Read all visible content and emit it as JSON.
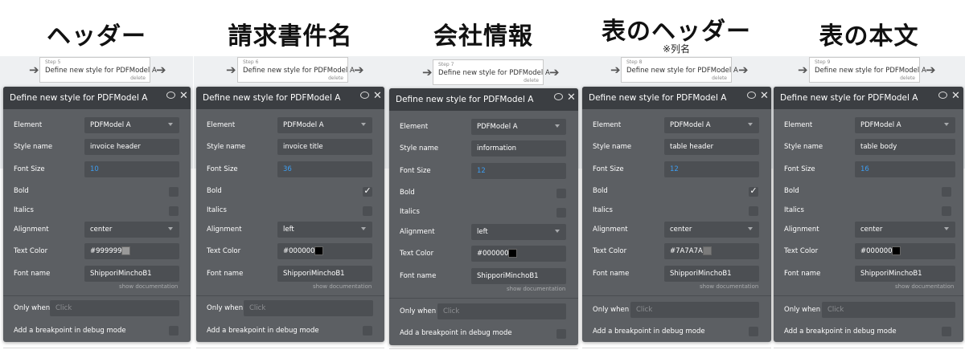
{
  "columns": [
    {
      "heading": "ヘッダー",
      "subnote": "",
      "step_number": "Step 5",
      "step_title": "Define new style for PDFModel A",
      "step_delete": "delete",
      "panel_title": "Define new style for PDFModel A",
      "element_label": "Element",
      "element_value": "PDFModel A",
      "style_label": "Style name",
      "style_value": "invoice header",
      "fontsize_label": "Font Size",
      "fontsize_value": "10",
      "bold_label": "Bold",
      "bold_checked": false,
      "italics_label": "Italics",
      "italics_checked": false,
      "align_label": "Alignment",
      "align_value": "center",
      "color_label": "Text Color",
      "color_value": "#999999",
      "color_hex": "#999999",
      "font_label": "Font name",
      "font_value": "ShipporiMinchoB1",
      "show_doc": "show documentation",
      "only_when_label": "Only when",
      "only_when_placeholder": "Click",
      "breakpoint_label": "Add a breakpoint in debug mode"
    },
    {
      "heading": "請求書件名",
      "subnote": "",
      "step_number": "Step 6",
      "step_title": "Define new style for PDFModel A",
      "step_delete": "delete",
      "panel_title": "Define new style for PDFModel A",
      "element_label": "Element",
      "element_value": "PDFModel A",
      "style_label": "Style name",
      "style_value": "invoice title",
      "fontsize_label": "Font Size",
      "fontsize_value": "36",
      "bold_label": "Bold",
      "bold_checked": true,
      "italics_label": "Italics",
      "italics_checked": false,
      "align_label": "Alignment",
      "align_value": "left",
      "color_label": "Text Color",
      "color_value": "#000000",
      "color_hex": "#000000",
      "font_label": "Font name",
      "font_value": "ShipporiMinchoB1",
      "show_doc": "show documentation",
      "only_when_label": "Only when",
      "only_when_placeholder": "Click",
      "breakpoint_label": "Add a breakpoint in debug mode"
    },
    {
      "heading": "会社情報",
      "subnote": "",
      "step_number": "Step 7",
      "step_title": "Define new style for PDFModel A",
      "step_delete": "delete",
      "panel_title": "Define new style for PDFModel A",
      "element_label": "Element",
      "element_value": "PDFModel A",
      "style_label": "Style name",
      "style_value": "information",
      "fontsize_label": "Font Size",
      "fontsize_value": "12",
      "bold_label": "Bold",
      "bold_checked": false,
      "italics_label": "Italics",
      "italics_checked": false,
      "align_label": "Alignment",
      "align_value": "left",
      "color_label": "Text Color",
      "color_value": "#000000",
      "color_hex": "#000000",
      "font_label": "Font name",
      "font_value": "ShipporiMinchoB1",
      "show_doc": "show documentation",
      "only_when_label": "Only when",
      "only_when_placeholder": "Click",
      "breakpoint_label": "Add a breakpoint in debug mode"
    },
    {
      "heading": "表のヘッダー",
      "subnote": "※列名",
      "step_number": "Step 8",
      "step_title": "Define new style for PDFModel A",
      "step_delete": "delete",
      "panel_title": "Define new style for PDFModel A",
      "element_label": "Element",
      "element_value": "PDFModel A",
      "style_label": "Style name",
      "style_value": "table header",
      "fontsize_label": "Font Size",
      "fontsize_value": "12",
      "bold_label": "Bold",
      "bold_checked": true,
      "italics_label": "Italics",
      "italics_checked": false,
      "align_label": "Alignment",
      "align_value": "center",
      "color_label": "Text Color",
      "color_value": "#7A7A7A",
      "color_hex": "#7A7A7A",
      "font_label": "Font name",
      "font_value": "ShipporiMinchoB1",
      "show_doc": "show documentation",
      "only_when_label": "Only when",
      "only_when_placeholder": "Click",
      "breakpoint_label": "Add a breakpoint in debug mode"
    },
    {
      "heading": "表の本文",
      "subnote": "",
      "step_number": "Step 9",
      "step_title": "Define new style for PDFModel A",
      "step_delete": "delete",
      "panel_title": "Define new style for PDFModel A",
      "element_label": "Element",
      "element_value": "PDFModel A",
      "style_label": "Style name",
      "style_value": "table body",
      "fontsize_label": "Font Size",
      "fontsize_value": "16",
      "bold_label": "Bold",
      "bold_checked": false,
      "italics_label": "Italics",
      "italics_checked": false,
      "align_label": "Alignment",
      "align_value": "center",
      "color_label": "Text Color",
      "color_value": "#000000",
      "color_hex": "#000000",
      "font_label": "Font name",
      "font_value": "ShipporiMinchoB1",
      "show_doc": "show documentation",
      "only_when_label": "Only when",
      "only_when_placeholder": "Click",
      "breakpoint_label": "Add a breakpoint in debug mode"
    }
  ]
}
